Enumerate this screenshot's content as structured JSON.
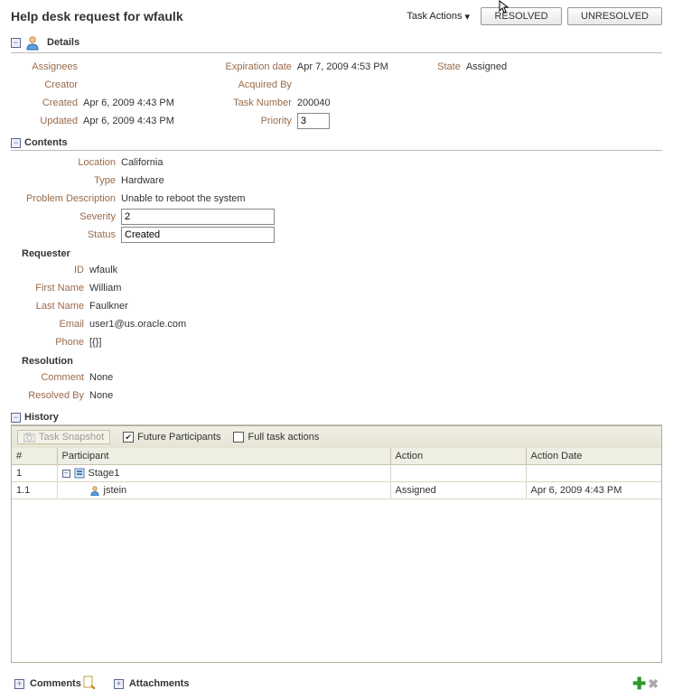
{
  "header": {
    "title": "Help desk request for wfaulk",
    "task_actions_label": "Task Actions",
    "resolved_btn": "RESOLVED",
    "unresolved_btn": "UNRESOLVED"
  },
  "details": {
    "section_title": "Details",
    "labels": {
      "assignees": "Assignees",
      "creator": "Creator",
      "created": "Created",
      "updated": "Updated",
      "expiration": "Expiration date",
      "acquired_by": "Acquired By",
      "task_number": "Task Number",
      "priority": "Priority",
      "state": "State"
    },
    "values": {
      "assignees": "",
      "creator": "",
      "created": "Apr 6, 2009 4:43 PM",
      "updated": "Apr 6, 2009 4:43 PM",
      "expiration": "Apr 7, 2009 4:53 PM",
      "acquired_by": "",
      "task_number": "200040",
      "priority": "3",
      "state": "Assigned"
    }
  },
  "contents": {
    "section_title": "Contents",
    "labels": {
      "location": "Location",
      "type": "Type",
      "problem_desc": "Problem Description",
      "severity": "Severity",
      "status": "Status"
    },
    "values": {
      "location": "California",
      "type": "Hardware",
      "problem_desc": "Unable to reboot the system",
      "severity": "2",
      "status": "Created"
    },
    "requester": {
      "title": "Requester",
      "labels": {
        "id": "ID",
        "first_name": "First Name",
        "last_name": "Last Name",
        "email": "Email",
        "phone": "Phone"
      },
      "values": {
        "id": "wfaulk",
        "first_name": "William",
        "last_name": "Faulkner",
        "email": "user1@us.oracle.com",
        "phone": "[{}]"
      }
    },
    "resolution": {
      "title": "Resolution",
      "labels": {
        "comment": "Comment",
        "resolved_by": "Resolved By"
      },
      "values": {
        "comment": "None",
        "resolved_by": "None"
      }
    }
  },
  "history": {
    "section_title": "History",
    "snapshot_label": "Task Snapshot",
    "future_participants_label": "Future Participants",
    "future_participants_checked": true,
    "full_task_actions_label": "Full task actions",
    "full_task_actions_checked": false,
    "columns": {
      "num": "#",
      "participant": "Participant",
      "action": "Action",
      "action_date": "Action Date"
    },
    "rows": [
      {
        "num": "1",
        "participant": "Stage1",
        "action": "",
        "action_date": "",
        "is_stage": true
      },
      {
        "num": "1.1",
        "participant": "jstein",
        "action": "Assigned",
        "action_date": "Apr 6, 2009 4:43 PM",
        "is_stage": false
      }
    ]
  },
  "bottom": {
    "comments_label": "Comments",
    "attachments_label": "Attachments"
  }
}
